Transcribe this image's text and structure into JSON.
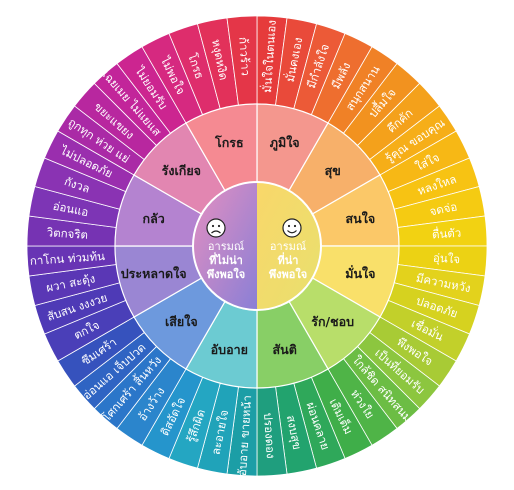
{
  "center": {
    "left_line1": "อารมณ์",
    "left_line2": "ที่ไม่น่า",
    "left_line3": "พึงพอใจ",
    "right_line1": "อารมณ์",
    "right_line2": "ที่น่า",
    "right_line3": "พึงพอใจ",
    "left_icon": "sad-face-icon",
    "right_icon": "happy-face-icon"
  },
  "segments": [
    {
      "label": "ภูมิใจ",
      "color": "#f4978e",
      "outer_color": "#e63b3b",
      "items": [
        "มั่นใจในตนเอง",
        "มั่นคงเอง",
        "มีกำลังใจ"
      ]
    },
    {
      "label": "สุข",
      "color": "#f7b06a",
      "outer_color": "#f08c20",
      "items": [
        "มีพลัง",
        "สนุกสนาน",
        "ปลื้มใจ"
      ]
    },
    {
      "label": "สนใจ",
      "color": "#fbc868",
      "outer_color": "#f4a320",
      "items": [
        "คึกคัก",
        "รู้คุณ ขอบคุณ",
        "ใส่ใจ"
      ]
    },
    {
      "label": "มั่นใจ",
      "color": "#f9e06a",
      "outer_color": "#f2c813",
      "items": [
        "หลงใหล",
        "จดจ่อ",
        "ตื่นตัว"
      ]
    },
    {
      "label": "รัก/ชอบ",
      "color": "#b8de6a",
      "outer_color": "#e3d21c",
      "items": [
        "อุ่นใจ",
        "มีความหวัง",
        "ปลอดภัย"
      ]
    },
    {
      "label": "สันติ",
      "color": "#88cf66",
      "outer_color": "#8cc63f",
      "items": [
        "เชื่อมั่น",
        "พึงพอใจ",
        "เป็นที่ยอมรับ"
      ]
    },
    {
      "label": "อับอาย",
      "color": "#6ccbd2",
      "outer_color": "#3fae49",
      "items": [
        "ใกล้ชิด สนิทสนม",
        "ห่วงใย",
        "เติมเต็ม"
      ]
    },
    {
      "label": "เสียใจ",
      "color": "#6d99dd",
      "outer_color": "#24a6c2",
      "items": [
        "ผ่อนคลาย",
        "สงบสุข",
        "ปรองดอง"
      ]
    },
    {
      "label": "ประหลาดใจ",
      "color": "#9a86d3",
      "outer_color": "#2b76c9",
      "items": [
        "อับอาย ขายหน้า",
        "ละอายใจ",
        "รู้สึกผิด"
      ]
    },
    {
      "label": "กลัว",
      "color": "#b483d0",
      "outer_color": "#4a3fb8",
      "items": [
        "ดิสอัดใจ",
        "อ้างว้าง",
        "โศกเศร้า สิ้นหวัง"
      ]
    },
    {
      "label": "รังเกียจ",
      "color": "#e286b1",
      "outer_color": "#7d35b5",
      "items": [
        "อ่อนแอ เจ็บปวด",
        "ซึมเศร้า",
        "ตกใจ"
      ]
    },
    {
      "label": "โกรธ",
      "color": "#f58a92",
      "outer_color": "#c2259a",
      "items": [
        "สับสน งงงวย",
        "ผวา สะดุ้ง",
        "กาโกน ท่วมท้น"
      ]
    }
  ],
  "outer_ring": [
    {
      "text": "มั่นใจในตนเอง",
      "color": "#e63b3b"
    },
    {
      "text": "มั่นคงเอง",
      "color": "#e94a3a"
    },
    {
      "text": "มีกำลังใจ",
      "color": "#ec5a37"
    },
    {
      "text": "มีพลัง",
      "color": "#ee6e2f"
    },
    {
      "text": "สนุกสนาน",
      "color": "#f08126"
    },
    {
      "text": "ปลื้มใจ",
      "color": "#f2921f"
    },
    {
      "text": "คึกคัก",
      "color": "#f4a11b"
    },
    {
      "text": "รู้คุณ ขอบคุณ",
      "color": "#f6ae18"
    },
    {
      "text": "ใส่ใจ",
      "color": "#f7b815"
    },
    {
      "text": "หลงใหล",
      "color": "#f7c313"
    },
    {
      "text": "จดจ่อ",
      "color": "#f5cb12"
    },
    {
      "text": "ตื่นตัว",
      "color": "#f2d212"
    },
    {
      "text": "อุ่นใจ",
      "color": "#ecd214"
    },
    {
      "text": "มีความหวัง",
      "color": "#e3d21c"
    },
    {
      "text": "ปลอดภัย",
      "color": "#d6d21f"
    },
    {
      "text": "เชื่อมั่น",
      "color": "#c2d02a"
    },
    {
      "text": "พึงพอใจ",
      "color": "#a8cb35"
    },
    {
      "text": "เป็นที่ยอมรับ",
      "color": "#8cc63f"
    },
    {
      "text": "ใกล้ชิด สนิทสนม",
      "color": "#6cbd44"
    },
    {
      "text": "ห่วงใย",
      "color": "#4fb447"
    },
    {
      "text": "เติมเต็ม",
      "color": "#3fae49"
    },
    {
      "text": "ผ่อนคลาย",
      "color": "#2fa85a"
    },
    {
      "text": "สงบสุข",
      "color": "#22a36e"
    },
    {
      "text": "ปรองดอง",
      "color": "#1f9e7e"
    },
    {
      "text": "อับอาย ขายหน้า",
      "color": "#1c9ea6"
    },
    {
      "text": "ละอายใจ",
      "color": "#20a3b9"
    },
    {
      "text": "รู้สึกผิด",
      "color": "#24a6c2"
    },
    {
      "text": "ดิสอัดใจ",
      "color": "#2595cc"
    },
    {
      "text": "อ้างว้าง",
      "color": "#2b85cc"
    },
    {
      "text": "โศกเศร้า สิ้นหวัง",
      "color": "#2b76c9"
    },
    {
      "text": "อ่อนแอ เจ็บปวด",
      "color": "#2f64c3"
    },
    {
      "text": "ซึมเศร้า",
      "color": "#3652bd"
    },
    {
      "text": "ตกใจ",
      "color": "#4a3fb8"
    },
    {
      "text": "สับสน งงงวย",
      "color": "#4e3ab6"
    },
    {
      "text": "ผวา สะดุ้ง",
      "color": "#5a37b5"
    },
    {
      "text": "กาโกน ท่วมท้น",
      "color": "#6834b4"
    },
    {
      "text": "วิตกจริต",
      "color": "#7633b3"
    },
    {
      "text": "อ่อนแอ",
      "color": "#7d35b5"
    },
    {
      "text": "กังวล",
      "color": "#8a33b3"
    },
    {
      "text": "ไม่ปลอดภัย",
      "color": "#9a2eae"
    },
    {
      "text": "ถูกทุก ห่วย แย่",
      "color": "#aa2aa6"
    },
    {
      "text": "ขยะแขยง",
      "color": "#b8279f"
    },
    {
      "text": "เฉยเมย ไม่แยแส",
      "color": "#c2259a"
    },
    {
      "text": "ไม่ยอมรับ",
      "color": "#cc2590"
    },
    {
      "text": "ไม่พอใจ",
      "color": "#d62980"
    },
    {
      "text": "โกรธ",
      "color": "#de2d6c"
    },
    {
      "text": "หงุดหงิด",
      "color": "#e2315a"
    },
    {
      "text": "ก้าวร้าว",
      "color": "#e43648"
    }
  ]
}
